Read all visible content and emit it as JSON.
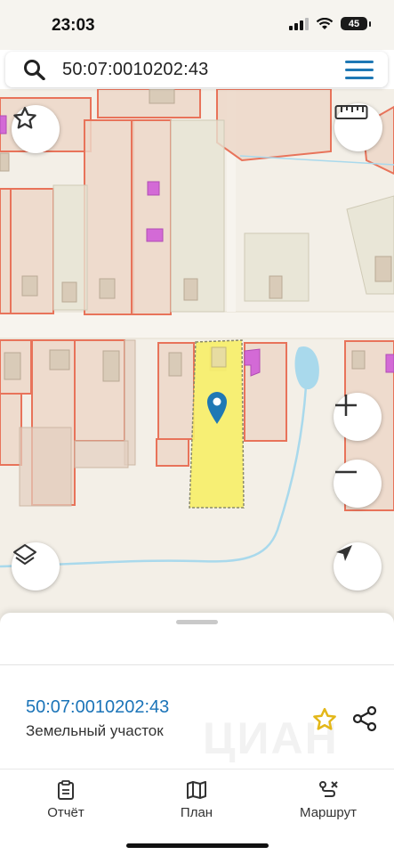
{
  "status_bar": {
    "time": "23:03",
    "battery": "45"
  },
  "search": {
    "query": "50:07:0010202:43"
  },
  "parcel": {
    "number": "50:07:0010202:43",
    "type": "Земельный участок"
  },
  "watermark": "ЦИАН",
  "tabs": [
    {
      "label": "Отчёт",
      "icon": "report-icon"
    },
    {
      "label": "План",
      "icon": "map-icon"
    },
    {
      "label": "Маршрут",
      "icon": "route-icon"
    }
  ],
  "colors": {
    "accent": "#1f78b4",
    "parcel_highlight": "#f7ef6a",
    "parcel_outline": "#e8735a",
    "building_fill": "#d36ad6",
    "favorite_star": "#e3b719"
  }
}
